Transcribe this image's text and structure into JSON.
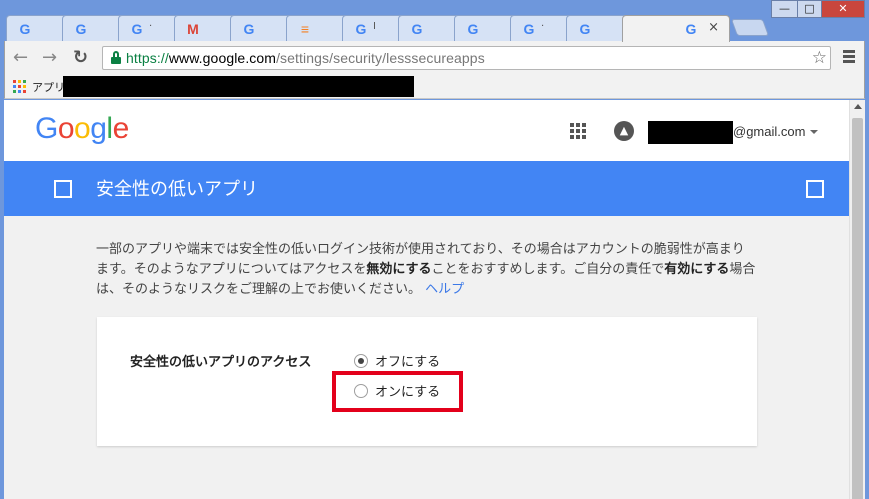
{
  "tabs": [
    {
      "icon": "G",
      "mark": ""
    },
    {
      "icon": "G",
      "mark": ""
    },
    {
      "icon": "G",
      "mark": "·"
    },
    {
      "icon": "M",
      "mark": ""
    },
    {
      "icon": "G",
      "mark": ""
    },
    {
      "icon": "≡",
      "mark": ""
    },
    {
      "icon": "G",
      "mark": "I"
    },
    {
      "icon": "G",
      "mark": ""
    },
    {
      "icon": "G",
      "mark": ""
    },
    {
      "icon": "G",
      "mark": "·"
    },
    {
      "icon": "G",
      "mark": ""
    },
    {
      "icon": "G",
      "mark": "",
      "active": true
    }
  ],
  "active_tab_close": "×",
  "window_controls": {
    "minimize": "—",
    "maximize": "□",
    "close": "✕"
  },
  "toolbar": {
    "url_scheme": "https://",
    "url_domain": "www.google.com",
    "url_path": "/settings/security/lesssecureapps",
    "star": "☆"
  },
  "bookmarks": {
    "apps_label": "アプリ"
  },
  "header": {
    "logo": "Google",
    "account_suffix": "@gmail.com"
  },
  "banner": {
    "title": "安全性の低いアプリ"
  },
  "description": {
    "part1": "一部のアプリや端末では安全性の低いログイン技術が使用されており、その場合はアカウントの脆弱性が高まります。そのようなアプリについてはアクセスを",
    "bold1": "無効にする",
    "part2": "ことをおすすめします。ご自分の責任で",
    "bold2": "有効にする",
    "part3": "場合は、そのようなリスクをご理解の上でお使いください。",
    "help_link": "ヘルプ"
  },
  "setting": {
    "label": "安全性の低いアプリのアクセス",
    "options": [
      {
        "label": "オフにする",
        "selected": true
      },
      {
        "label": "オンにする",
        "selected": false
      }
    ]
  },
  "colors": {
    "brand_blue": "#4285f4",
    "highlight_red": "#e3001b",
    "secure_green": "#0b8043"
  }
}
